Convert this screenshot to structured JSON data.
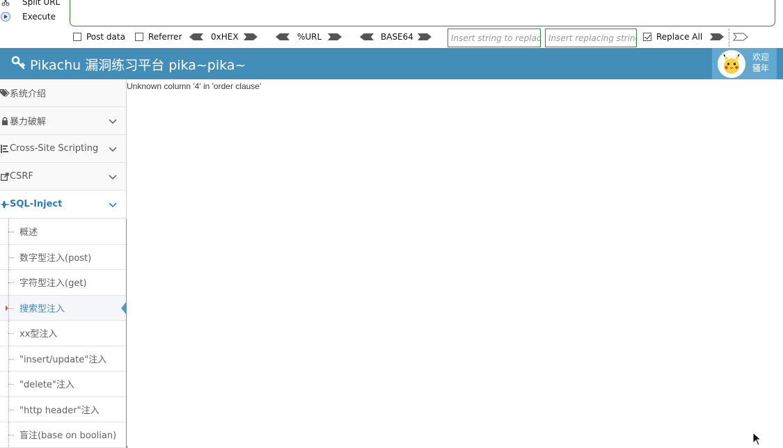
{
  "hackbar": {
    "split_url_label": "Split URL",
    "execute_label": "Execute",
    "url_value": "",
    "post_data_label": "Post data",
    "post_data_checked": false,
    "referrer_label": "Referrer",
    "referrer_checked": false,
    "hex_label": "0xHEX",
    "url_encode_label": "%URL",
    "base64_label": "BASE64",
    "find_placeholder": "Insert string to replace",
    "replace_placeholder": "Insert replacing string",
    "replace_all_label": "Replace All",
    "replace_all_checked": true
  },
  "header": {
    "brand": "Pikachu 漏洞练习平台 pika~pika~",
    "welcome_line1": "欢迎",
    "welcome_line2": "骚年"
  },
  "sidebar": {
    "items": [
      {
        "label": "系统介绍",
        "icon": "tags-icon",
        "has_chevron": false
      },
      {
        "label": "暴力破解",
        "icon": "lock-icon",
        "has_chevron": true
      },
      {
        "label": "Cross-Site Scripting",
        "icon": "list-icon",
        "has_chevron": true
      },
      {
        "label": "CSRF",
        "icon": "share-icon",
        "has_chevron": true
      },
      {
        "label": "SQL-Inject",
        "icon": "fighter-jet-icon",
        "has_chevron": true,
        "active": true
      }
    ],
    "sub_items": [
      {
        "label": "概述"
      },
      {
        "label": "数字型注入(post)"
      },
      {
        "label": "字符型注入(get)"
      },
      {
        "label": "搜索型注入",
        "active": true
      },
      {
        "label": "xx型注入"
      },
      {
        "label": "\"insert/update\"注入"
      },
      {
        "label": "\"delete\"注入"
      },
      {
        "label": "\"http header\"注入"
      },
      {
        "label": "盲注(base on boolian)"
      }
    ]
  },
  "main": {
    "message": "Unknown column '4' in 'order clause'"
  },
  "colors": {
    "header_bg": "#438eb9",
    "accent": "#2b7dbc",
    "hackbar_border": "#2f8a2f"
  }
}
